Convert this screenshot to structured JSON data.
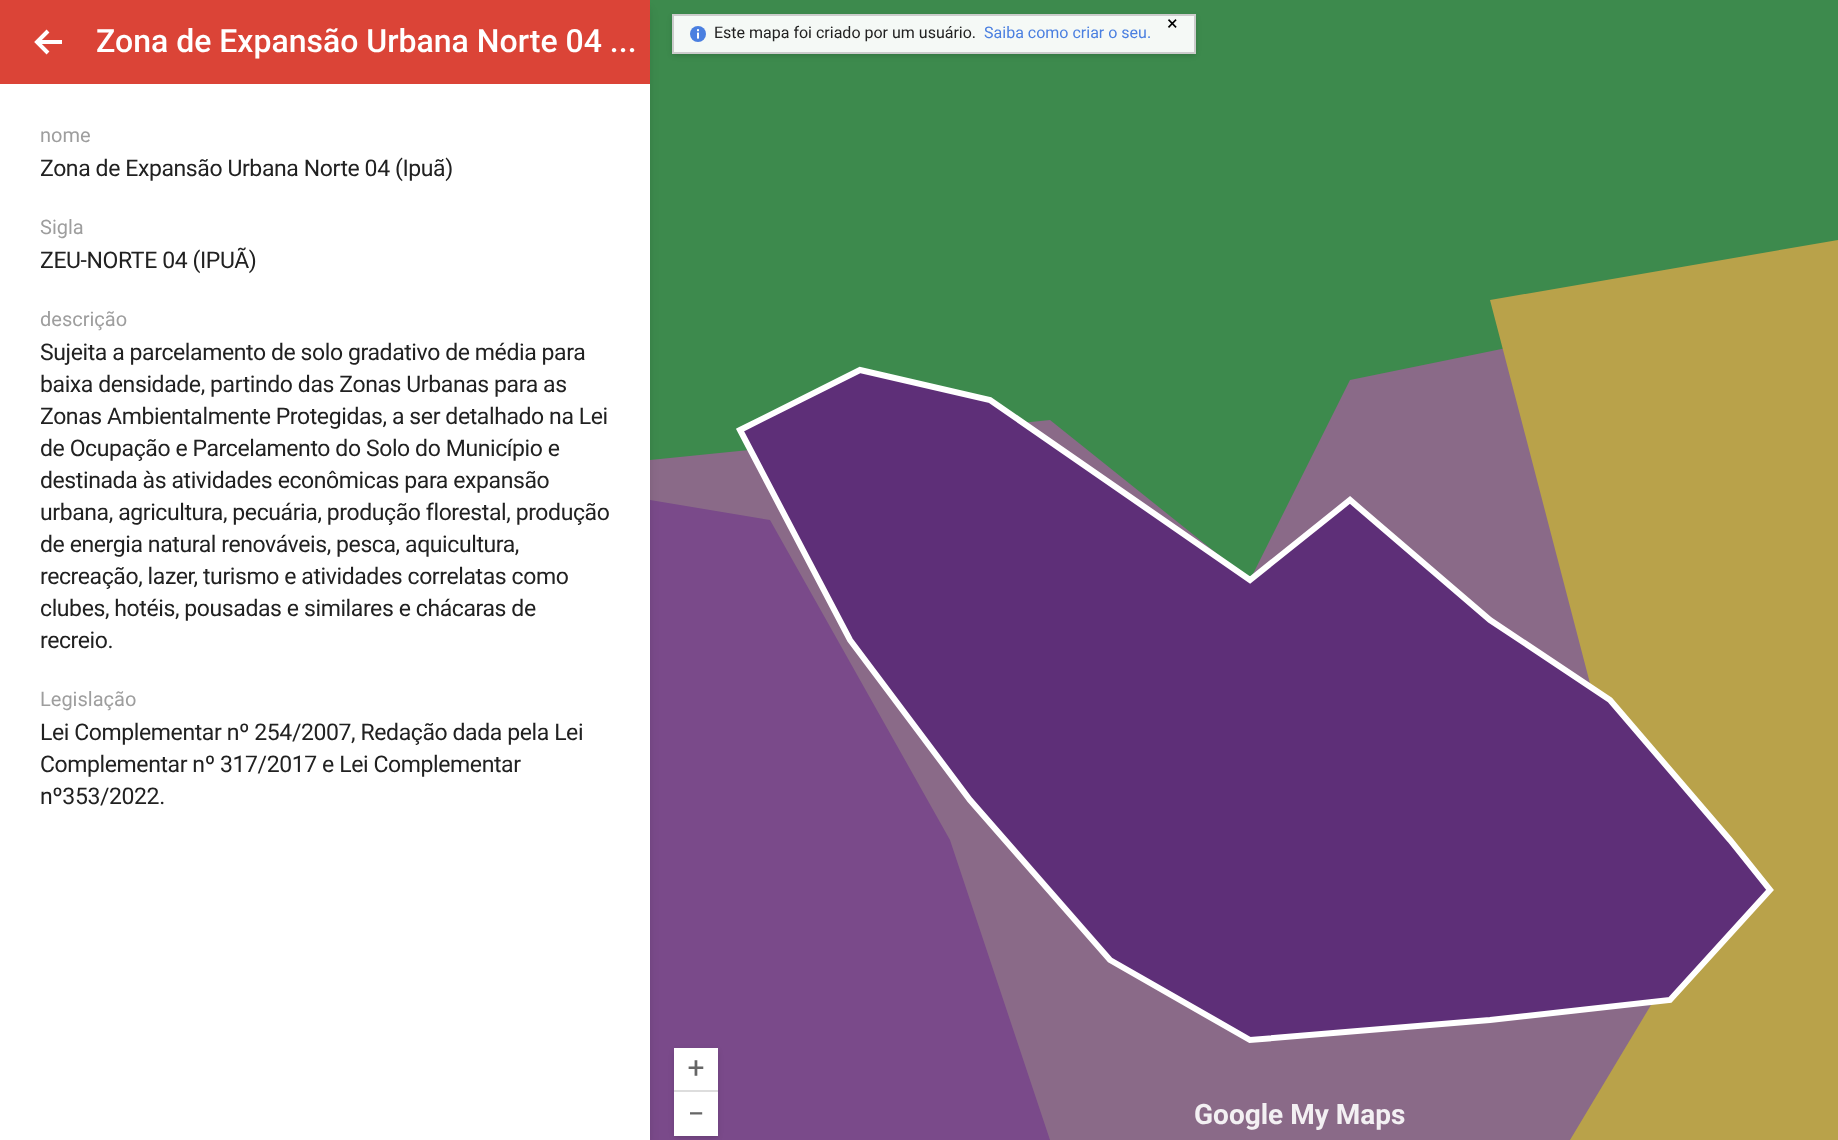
{
  "panel": {
    "title": "Zona de Expansão Urbana Norte 04 ...",
    "fields": [
      {
        "label": "nome",
        "value": "Zona de Expansão Urbana Norte 04 (Ipuã)"
      },
      {
        "label": "Sigla",
        "value": "ZEU-NORTE 04 (IPUÃ)"
      },
      {
        "label": "descrição",
        "value": "Sujeita a parcelamento de solo gradativo de média para baixa densidade, partindo das Zonas Urbanas para as Zonas Ambientalmente Protegidas, a ser detalhado na Lei de Ocupação e Parcelamento do Solo do Município e destinada às atividades econômicas para expansão urbana, agricultura, pecuária, produção florestal, produção de energia natural renováveis, pesca, aquicultura, recreação, lazer, turismo e atividades correlatas como clubes, hotéis, pousadas e similares e chácaras de recreio."
      },
      {
        "label": "Legislação",
        "value": "Lei Complementar nº 254/2007, Redação dada pela Lei Complementar nº 317/2017 e Lei Complementar nº353/2022."
      }
    ]
  },
  "map": {
    "notice": {
      "text": "Este mapa foi criado por um usuário.",
      "link": "Saiba como criar o seu.",
      "close": "×"
    },
    "zoom_buttons": [
      "+",
      "−"
    ],
    "logo": "Google My Maps"
  }
}
